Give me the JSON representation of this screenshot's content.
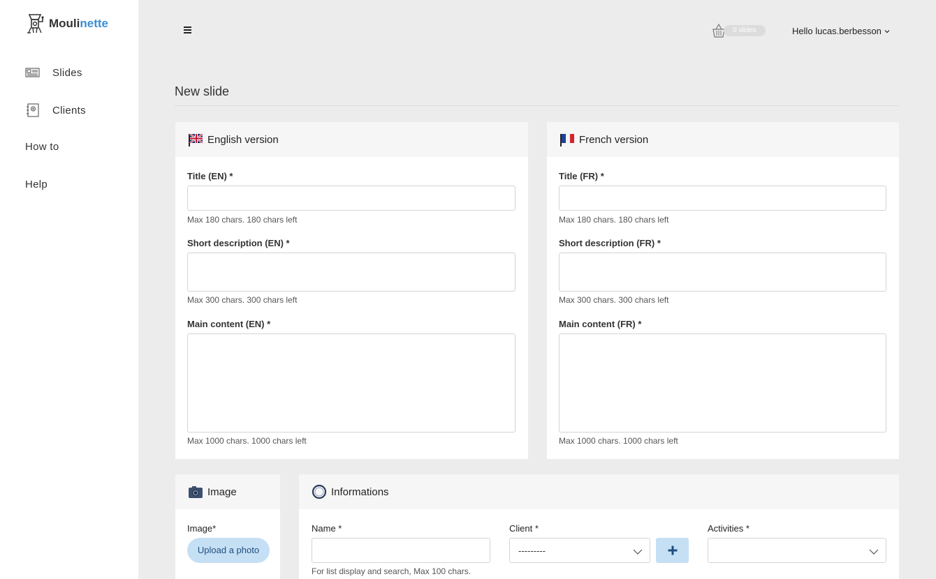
{
  "brand": {
    "name_prefix": "Mouli",
    "name_accent": "nette",
    "accent_color": "#3a8ed4"
  },
  "sidebar": {
    "items": [
      {
        "label": "Slides",
        "icon": "slides-icon"
      },
      {
        "label": "Clients",
        "icon": "clients-icon"
      },
      {
        "label": "How to"
      },
      {
        "label": "Help"
      }
    ]
  },
  "topbar": {
    "menu_icon": "hamburger-icon",
    "cart_icon": "basket-icon",
    "cart_badge": "0 slides",
    "user_greeting": "Hello lucas.berbesson"
  },
  "page": {
    "title": "New slide"
  },
  "english": {
    "header": "English version",
    "title_label": "Title (EN) *",
    "title_help": "Max 180 chars. 180 chars left",
    "short_label": "Short description (EN) *",
    "short_help": "Max 300 chars. 300 chars left",
    "main_label": "Main content (EN) *",
    "main_help": "Max 1000 chars. 1000 chars left"
  },
  "french": {
    "header": "French version",
    "title_label": "Title (FR) *",
    "title_help": "Max 180 chars. 180 chars left",
    "short_label": "Short description (FR) *",
    "short_help": "Max 300 chars. 300 chars left",
    "main_label": "Main content (FR) *",
    "main_help": "Max 1000 chars. 1000 chars left"
  },
  "image": {
    "header": "Image",
    "field_label": "Image*",
    "upload_label": "Upload a photo"
  },
  "informations": {
    "header": "Informations",
    "name_label": "Name *",
    "name_help": "For list display and search, Max 100 chars.",
    "client_label": "Client *",
    "client_value": "---------",
    "add_client_label": "+",
    "activities_label": "Activities *",
    "activities_value": ""
  }
}
